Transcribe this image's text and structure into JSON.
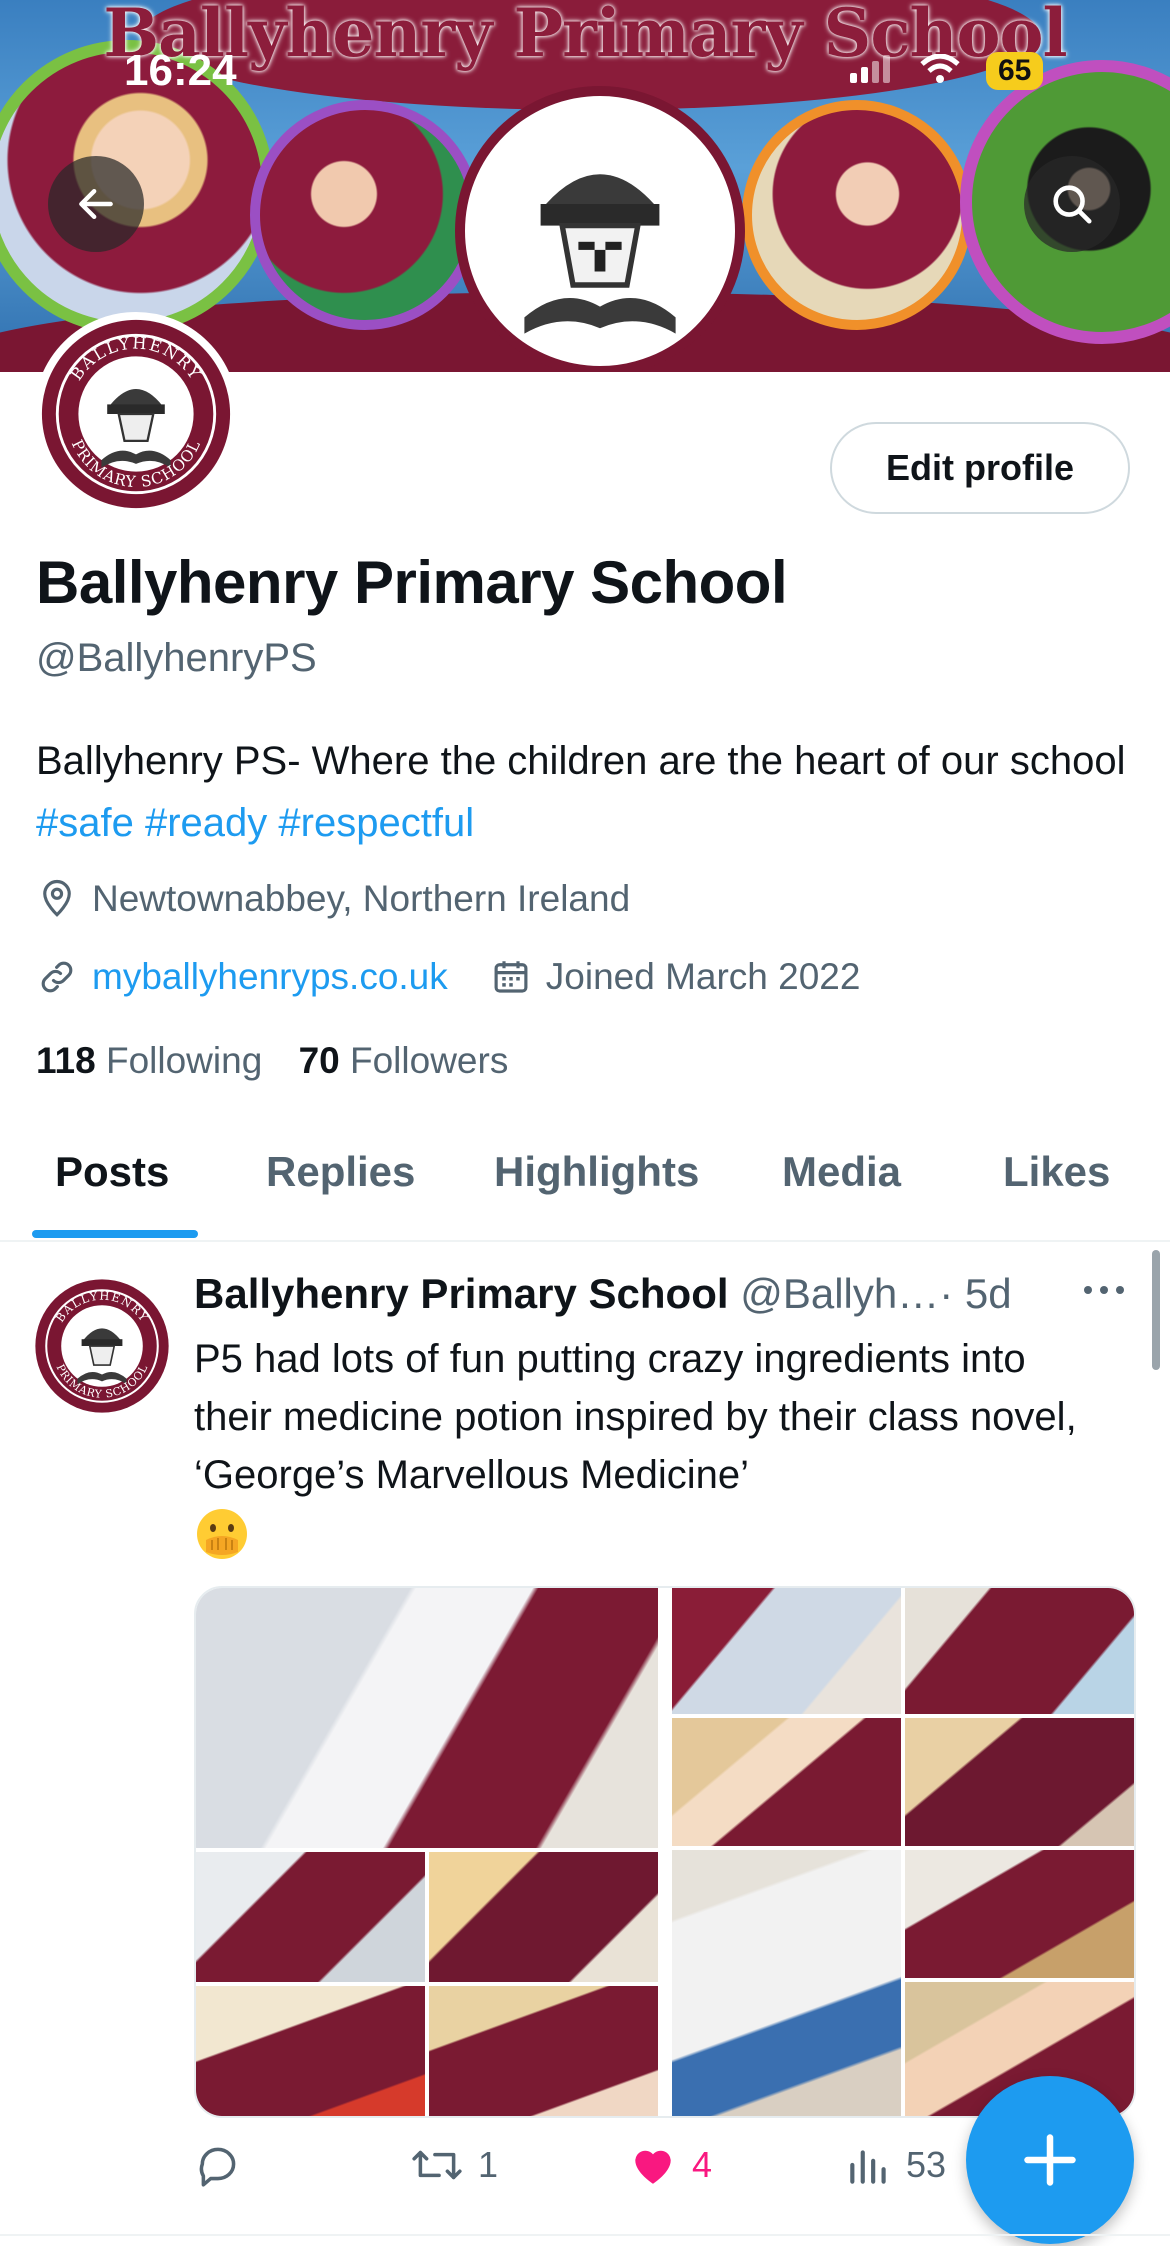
{
  "status_bar": {
    "time": "16:24",
    "battery": "65"
  },
  "banner": {
    "title": "Ballyhenry Primary School"
  },
  "logo": {
    "text_top": "BALLYHENRY",
    "text_bottom": "PRIMARY SCHOOL"
  },
  "profile": {
    "edit_label": "Edit profile",
    "name": "Ballyhenry Primary School",
    "handle": "@BallyhenryPS",
    "bio_text": "Ballyhenry PS- Where the children are the heart of our school ",
    "hashtags": [
      "#safe",
      "#ready",
      "#respectful"
    ],
    "location": "Newtownabbey, Northern Ireland",
    "website": "myballyhenryps.co.uk",
    "joined": "Joined March 2022",
    "following_count": "118",
    "following_label": "Following",
    "followers_count": "70",
    "followers_label": "Followers"
  },
  "tabs": [
    {
      "label": "Posts",
      "active": true
    },
    {
      "label": "Replies",
      "active": false
    },
    {
      "label": "Highlights",
      "active": false
    },
    {
      "label": "Media",
      "active": false
    },
    {
      "label": "Likes",
      "active": false
    }
  ],
  "post": {
    "author": "Ballyhenry Primary School",
    "handle": "@Ballyh…",
    "time": "· 5d",
    "text": "P5 had lots of fun putting crazy ingredients into their medicine potion inspired by their class novel, ‘George’s Marvellous Medicine’",
    "emoji": "face-with-hand-over-mouth",
    "replies": "",
    "reposts": "1",
    "likes": "4",
    "views": "53"
  },
  "colors": {
    "accent": "#1d9bf0",
    "like": "#f91880",
    "brand_maroon": "#7a1632",
    "text": "#0f1419",
    "muted": "#536471"
  }
}
